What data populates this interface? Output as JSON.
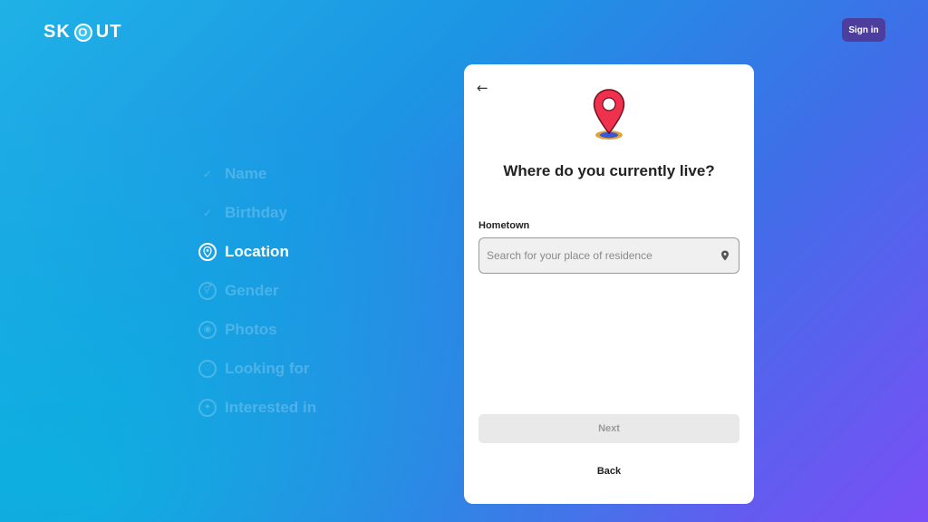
{
  "header": {
    "logo_prefix": "SK",
    "logo_o": "O",
    "logo_suffix": "UT",
    "signin_label": "Sign in"
  },
  "steps": [
    {
      "label": "Name",
      "status": "done",
      "icon": "check-icon"
    },
    {
      "label": "Birthday",
      "status": "done",
      "icon": "check-icon"
    },
    {
      "label": "Location",
      "status": "active",
      "icon": "location-pin-icon"
    },
    {
      "label": "Gender",
      "status": "pending",
      "icon": "gender-icon"
    },
    {
      "label": "Photos",
      "status": "pending",
      "icon": "camera-icon"
    },
    {
      "label": "Looking for",
      "status": "pending",
      "icon": "heart-icon"
    },
    {
      "label": "Interested in",
      "status": "pending",
      "icon": "lightbulb-icon"
    }
  ],
  "card": {
    "back_arrow": "←",
    "title": "Where do you currently live?",
    "field_label": "Hometown",
    "search_placeholder": "Search for your place of residence",
    "search_value": "",
    "next_label": "Next",
    "back_label": "Back"
  },
  "colors": {
    "pin_red": "#f0314e",
    "signin_bg": "#4d3e9e",
    "gradient_start": "#1fb2e6",
    "gradient_end": "#7a4ff5"
  }
}
